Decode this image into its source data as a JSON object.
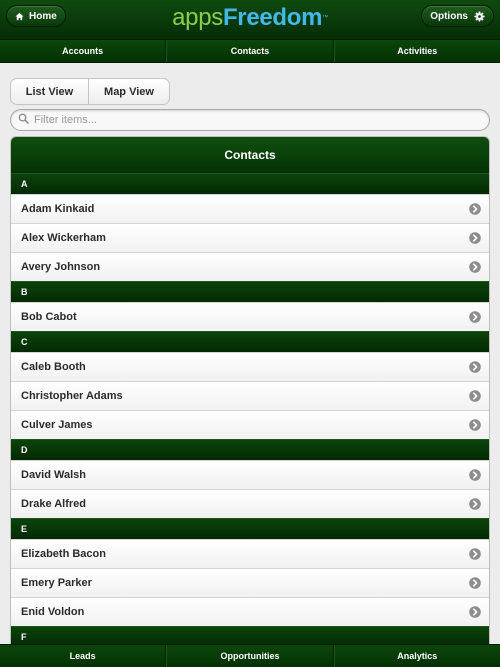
{
  "header": {
    "home_label": "Home",
    "home_icon": "home-icon",
    "logo_apps": "apps",
    "logo_freedom": "Freedom",
    "logo_tm": "™",
    "options_label": "Options",
    "options_icon": "gear-icon",
    "colors": {
      "logo_apps": "#8ccd4a",
      "logo_freedom": "#42b8ea",
      "bar": "#0a3d0a"
    }
  },
  "top_nav": [
    "Accounts",
    "Contacts",
    "Activities"
  ],
  "view_toggle": {
    "list": "List View",
    "map": "Map View"
  },
  "filter": {
    "placeholder": "Filter items...",
    "value": "",
    "icon": "search-icon"
  },
  "list": {
    "title": "Contacts",
    "groups": [
      {
        "letter": "A",
        "items": [
          "Adam Kinkaid",
          "Alex Wickerham",
          "Avery Johnson"
        ]
      },
      {
        "letter": "B",
        "items": [
          "Bob Cabot"
        ]
      },
      {
        "letter": "C",
        "items": [
          "Caleb Booth",
          "Christopher Adams",
          "Culver James"
        ]
      },
      {
        "letter": "D",
        "items": [
          "David Walsh",
          "Drake Alfred"
        ]
      },
      {
        "letter": "E",
        "items": [
          "Elizabeth Bacon",
          "Emery Parker",
          "Enid Voldon"
        ]
      },
      {
        "letter": "F",
        "items": []
      }
    ],
    "row_icon": "chevron-right-circle-icon"
  },
  "bottom_nav": [
    "Leads",
    "Opportunities",
    "Analytics"
  ]
}
